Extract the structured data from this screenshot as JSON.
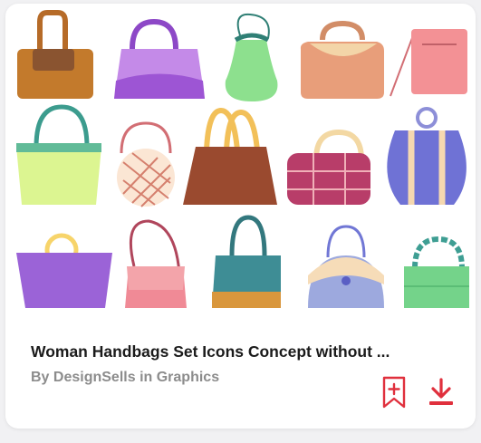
{
  "card": {
    "title": "Woman Handbags Set Icons Concept without ...",
    "by_prefix": "By",
    "author": "DesignSells",
    "in_word": "in",
    "category": "Graphics"
  },
  "thumbnail": {
    "icons": [
      "brown-tote-icon",
      "purple-handbag-icon",
      "green-clasp-purse-icon",
      "peach-bag-icon",
      "pink-crossbody-icon",
      "lime-tote-icon",
      "round-lattice-bag-icon",
      "brown-tote-icon",
      "plaid-duffel-icon",
      "striped-bucket-bag-icon",
      "ring-handle-bag-icon",
      "pink-shoulder-bag-icon",
      "teal-tote-icon",
      "half-moon-bag-icon",
      "chain-handle-bag-icon"
    ]
  },
  "actions": {
    "bookmark_icon": "bookmark-plus-icon",
    "download_icon": "download-icon",
    "accent_color": "#e0303d"
  }
}
